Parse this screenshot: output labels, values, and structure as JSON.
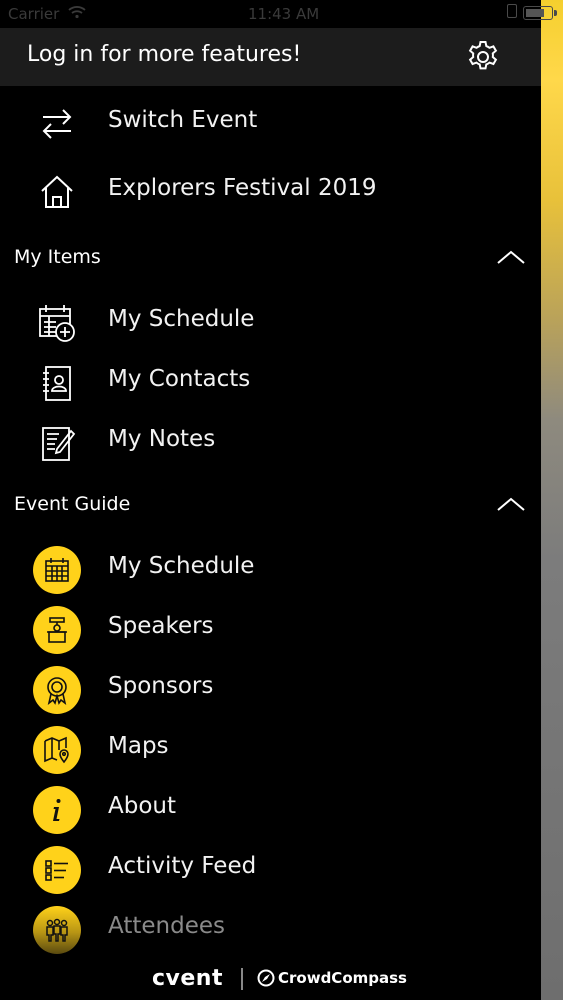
{
  "status_bar": {
    "carrier": "Carrier",
    "time": "11:43 AM"
  },
  "header": {
    "login_text": "Log in for more features!",
    "settings_icon": "gear-icon"
  },
  "top_items": [
    {
      "label": "Switch Event",
      "icon": "switch-arrows-icon"
    },
    {
      "label": "Explorers Festival 2019",
      "icon": "home-icon"
    }
  ],
  "sections": {
    "my_items": {
      "title": "My Items",
      "items": [
        {
          "label": "My Schedule",
          "icon": "calendar-add-icon"
        },
        {
          "label": "My Contacts",
          "icon": "contact-book-icon"
        },
        {
          "label": "My Notes",
          "icon": "note-edit-icon"
        }
      ]
    },
    "event_guide": {
      "title": "Event Guide",
      "items": [
        {
          "label": "My Schedule",
          "icon": "calendar-grid-icon"
        },
        {
          "label": "Speakers",
          "icon": "podium-icon"
        },
        {
          "label": "Sponsors",
          "icon": "award-ribbon-icon"
        },
        {
          "label": "Maps",
          "icon": "map-pin-icon"
        },
        {
          "label": "About",
          "icon": "info-icon"
        },
        {
          "label": "Activity Feed",
          "icon": "list-feed-icon"
        },
        {
          "label": "Attendees",
          "icon": "people-group-icon"
        }
      ]
    }
  },
  "footer": {
    "brand_primary": "cvent",
    "brand_secondary": "CrowdCompass"
  },
  "colors": {
    "accent": "#ffd21a",
    "header_bg": "#1c1c1c",
    "background": "#000000"
  }
}
